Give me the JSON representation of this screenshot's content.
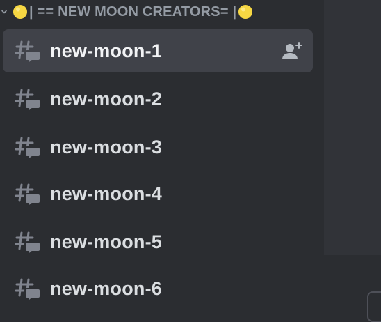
{
  "category": {
    "title": "| == NEW MOON CREATORS= |",
    "chevron_icon": "chevron-down-icon",
    "emoji_icon": "yellow-circle-emoji"
  },
  "channels": [
    {
      "name": "new-moon-1",
      "icon": "text-thread-channel-icon",
      "active": true,
      "action_icon": "add-member-icon"
    },
    {
      "name": "new-moon-2",
      "icon": "text-thread-channel-icon"
    },
    {
      "name": "new-moon-3",
      "icon": "text-thread-channel-icon"
    },
    {
      "name": "new-moon-4",
      "icon": "text-thread-channel-icon"
    },
    {
      "name": "new-moon-5",
      "icon": "text-thread-channel-icon"
    },
    {
      "name": "new-moon-6",
      "icon": "text-thread-channel-icon"
    }
  ],
  "colors": {
    "sidebar_bg": "#2b2d31",
    "active_bg": "#404249",
    "text": "#dbdee1",
    "muted": "#949ba4",
    "emoji_yellow": "#f6d743"
  }
}
